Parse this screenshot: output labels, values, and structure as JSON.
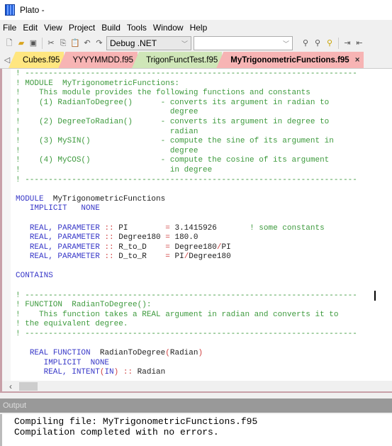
{
  "window": {
    "title": "Plato -"
  },
  "menu": [
    "File",
    "Edit",
    "View",
    "Project",
    "Build",
    "Tools",
    "Window",
    "Help"
  ],
  "toolbar": {
    "icons": [
      "new-file-icon",
      "open-folder-icon",
      "save-icon",
      "cut-icon",
      "copy-icon",
      "paste-icon",
      "undo-icon",
      "redo-icon"
    ],
    "config": "Debug .NET",
    "search_value": "",
    "right_icons": [
      "find-icon",
      "find-next-icon",
      "replace-icon",
      "indent-icon",
      "outdent-icon"
    ]
  },
  "tabs": [
    {
      "label": "Cubes.f95",
      "color": "#ffe680",
      "active": false
    },
    {
      "label": "YYYYMMDD.f95",
      "color": "#f7b4b4",
      "active": false
    },
    {
      "label": "TrigonFunctTest.f95",
      "color": "#cfe6b8",
      "active": false
    },
    {
      "label": "MyTrigonometricFunctions.f95",
      "color": "#f7b4b4",
      "active": true
    }
  ],
  "tab_close": "×",
  "colors": {
    "comment": "#3d9a3d",
    "keyword": "#3838c8",
    "operator": "#d04040"
  },
  "code": [
    [
      [
        "c",
        "! -----------------------------------------------------------------------"
      ]
    ],
    [
      [
        "c",
        "! MODULE  MyTrigonometricFunctions:"
      ]
    ],
    [
      [
        "c",
        "!    This module provides the following functions and constants"
      ]
    ],
    [
      [
        "c",
        "!    (1) RadianToDegree()      - converts its argument in radian to"
      ]
    ],
    [
      [
        "c",
        "!                                degree"
      ]
    ],
    [
      [
        "c",
        "!    (2) DegreeToRadian()      - converts its argument in degree to"
      ]
    ],
    [
      [
        "c",
        "!                                radian"
      ]
    ],
    [
      [
        "c",
        "!    (3) MySIN()               - compute the sine of its argument in"
      ]
    ],
    [
      [
        "c",
        "!                                degree"
      ]
    ],
    [
      [
        "c",
        "!    (4) MyCOS()               - compute the cosine of its argument"
      ]
    ],
    [
      [
        "c",
        "!                                in degree"
      ]
    ],
    [
      [
        "c",
        "! -----------------------------------------------------------------------"
      ]
    ],
    [],
    [
      [
        "k",
        "MODULE"
      ],
      [
        "n",
        "  MyTrigonometricFunctions"
      ]
    ],
    [
      [
        "n",
        "   "
      ],
      [
        "k",
        "IMPLICIT   NONE"
      ]
    ],
    [],
    [
      [
        "n",
        "   "
      ],
      [
        "k",
        "REAL, PARAMETER "
      ],
      [
        "o",
        "::"
      ],
      [
        "n",
        " PI        "
      ],
      [
        "o",
        "="
      ],
      [
        "n",
        " 3.1415926       "
      ],
      [
        "c",
        "! some constants"
      ]
    ],
    [
      [
        "n",
        "   "
      ],
      [
        "k",
        "REAL, PARAMETER "
      ],
      [
        "o",
        "::"
      ],
      [
        "n",
        " Degree180 "
      ],
      [
        "o",
        "="
      ],
      [
        "n",
        " 180.0"
      ]
    ],
    [
      [
        "n",
        "   "
      ],
      [
        "k",
        "REAL, PARAMETER "
      ],
      [
        "o",
        "::"
      ],
      [
        "n",
        " R_to_D    "
      ],
      [
        "o",
        "="
      ],
      [
        "n",
        " Degree180"
      ],
      [
        "o",
        "/"
      ],
      [
        "n",
        "PI"
      ]
    ],
    [
      [
        "n",
        "   "
      ],
      [
        "k",
        "REAL, PARAMETER "
      ],
      [
        "o",
        "::"
      ],
      [
        "n",
        " D_to_R    "
      ],
      [
        "o",
        "="
      ],
      [
        "n",
        " PI"
      ],
      [
        "o",
        "/"
      ],
      [
        "n",
        "Degree180"
      ]
    ],
    [],
    [
      [
        "k",
        "CONTAINS"
      ]
    ],
    [],
    [
      [
        "c",
        "! -----------------------------------------------------------------------"
      ]
    ],
    [
      [
        "c",
        "! FUNCTION  RadianToDegree():"
      ]
    ],
    [
      [
        "c",
        "!    This function takes a REAL argument in radian and converts it to"
      ]
    ],
    [
      [
        "c",
        "! the equivalent degree."
      ]
    ],
    [
      [
        "c",
        "! -----------------------------------------------------------------------"
      ]
    ],
    [],
    [
      [
        "n",
        "   "
      ],
      [
        "k",
        "REAL FUNCTION"
      ],
      [
        "n",
        "  RadianToDegree"
      ],
      [
        "o",
        "("
      ],
      [
        "n",
        "Radian"
      ],
      [
        "o",
        ")"
      ]
    ],
    [
      [
        "n",
        "      "
      ],
      [
        "k",
        "IMPLICIT  NONE"
      ]
    ],
    [
      [
        "n",
        "      "
      ],
      [
        "k",
        "REAL, INTENT"
      ],
      [
        "o",
        "("
      ],
      [
        "k",
        "IN"
      ],
      [
        "o",
        ") ::"
      ],
      [
        "n",
        " Radian"
      ]
    ]
  ],
  "output": {
    "title": "Output",
    "lines": [
      "Compiling file: MyTrigonometricFunctions.f95",
      "Compilation completed with no errors."
    ]
  }
}
